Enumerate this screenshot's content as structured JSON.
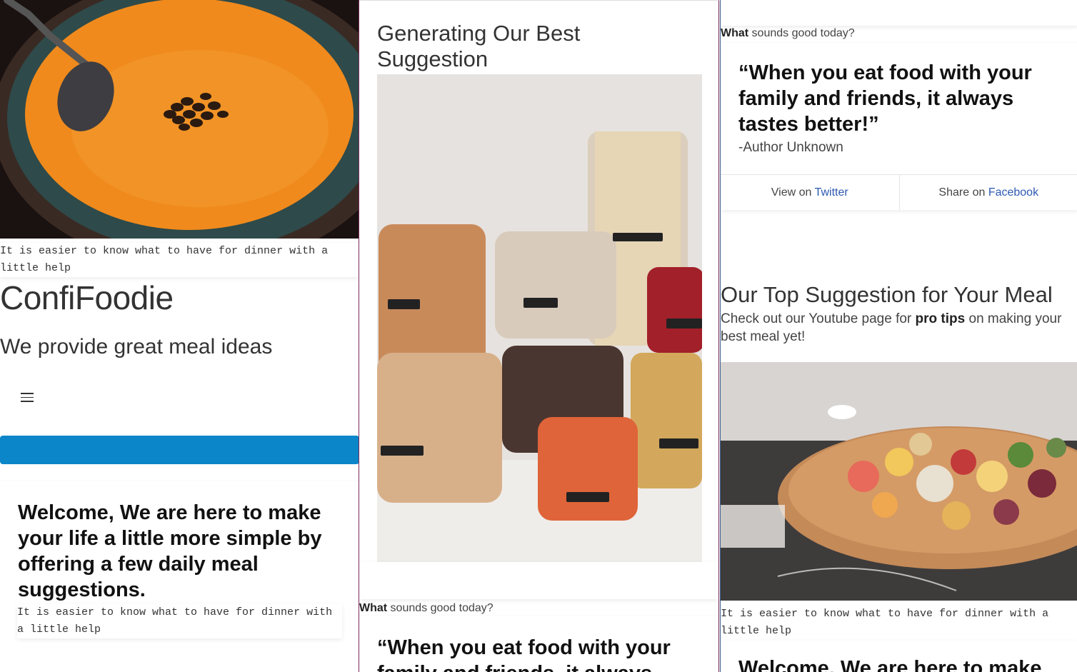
{
  "caption": "It is easier to know what to have for dinner with a little help",
  "header": {
    "brand": "ConfiFoodie",
    "tagline": "We provide great meal ideas"
  },
  "welcome": {
    "heading": "Welcome, We are here to make your life a little more simple by offering a few daily meal suggestions.",
    "heading_cut": "Welcome, We are here to make"
  },
  "suggestion": {
    "title": "Generating Our Best Suggestion",
    "prompt_bold": "What",
    "prompt_rest": " sounds good today?"
  },
  "quote": {
    "text": "“When you eat food with your family and friends, it always tastes better!”",
    "text_cut": "“When you eat food with your family and friends, it always",
    "author": "-Author Unknown",
    "view_prefix": "View on ",
    "view_link": "Twitter",
    "share_prefix": "Share on ",
    "share_link": "Facebook"
  },
  "top_suggestion": {
    "title": "Our Top Suggestion for Your Meal",
    "text_before": "Check out our Youtube page for ",
    "text_bold": "pro tips",
    "text_after": " on making your best meal yet!"
  },
  "colors": {
    "accent_bar": "#0a86c9",
    "link": "#2d5ab0",
    "soup": "#f08a1c"
  },
  "icons": {
    "menu": "hamburger-menu-icon"
  }
}
